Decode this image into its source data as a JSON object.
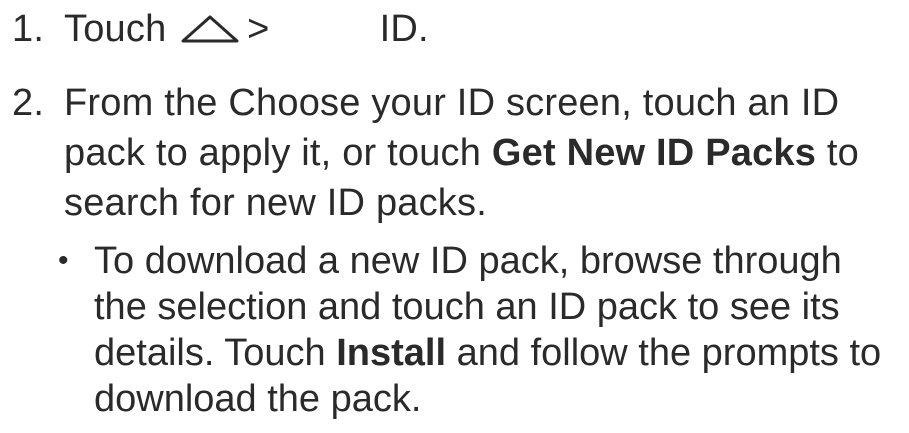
{
  "step1": {
    "number": "1.",
    "prefix": "Touch",
    "separator": ">",
    "suffix": "ID.",
    "icon": "home-icon"
  },
  "step2": {
    "number": "2.",
    "line1": "From the Choose your ID screen, touch an ID",
    "line2_pre": "pack to apply it, or touch ",
    "line2_bold": "Get New ID Packs",
    "line2_post": " to",
    "line3": "search for new ID packs."
  },
  "bullet": {
    "dot": "•",
    "line1": "To download a new ID pack, browse through",
    "line2": "the selection and touch an ID pack to see its",
    "line3_pre": "details. Touch ",
    "line3_bold": "Install",
    "line3_post": " and follow the prompts to",
    "line4": "download the pack."
  }
}
